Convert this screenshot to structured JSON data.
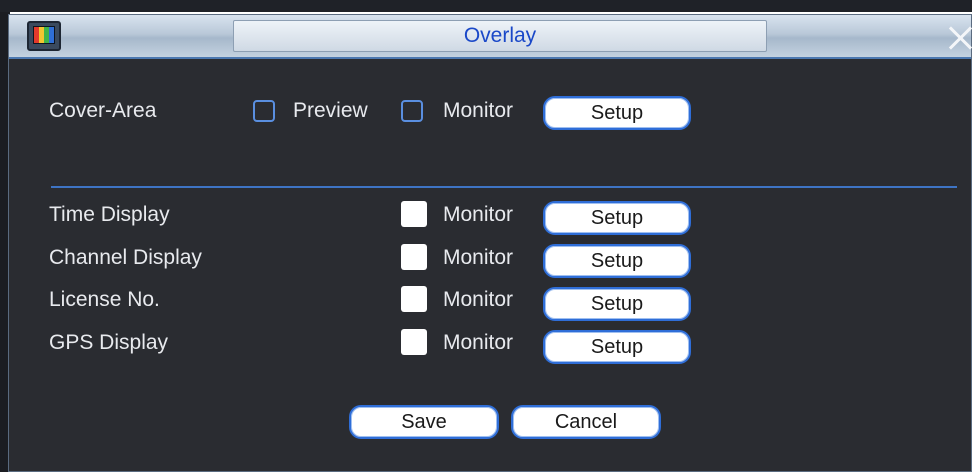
{
  "window": {
    "title": "Overlay"
  },
  "cover_area": {
    "label": "Cover-Area",
    "preview_label": "Preview",
    "monitor_label": "Monitor",
    "setup_label": "Setup"
  },
  "rows": [
    {
      "label": "Time Display",
      "monitor_label": "Monitor",
      "setup_label": "Setup"
    },
    {
      "label": "Channel Display",
      "monitor_label": "Monitor",
      "setup_label": "Setup"
    },
    {
      "label": "License No.",
      "monitor_label": "Monitor",
      "setup_label": "Setup"
    },
    {
      "label": "GPS Display",
      "monitor_label": "Monitor",
      "setup_label": "Setup"
    }
  ],
  "footer": {
    "save_label": "Save",
    "cancel_label": "Cancel"
  },
  "colors": {
    "dialog_bg": "#2a2c31",
    "accent": "#2f6ed8",
    "title_text": "#1a48c8"
  },
  "icons": {
    "app": "monitor-app-icon",
    "close": "close-icon"
  }
}
